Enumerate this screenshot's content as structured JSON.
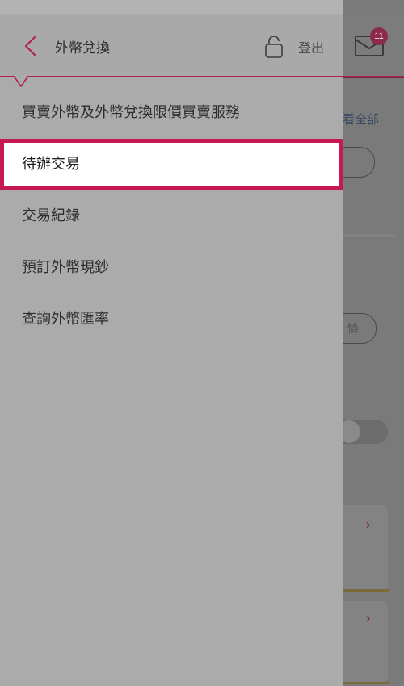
{
  "header": {
    "title": "外幣兌換",
    "logout_label": "登出",
    "mail_badge_count": "11"
  },
  "menu": {
    "items": [
      {
        "label": "買賣外幣及外幣兌換限價買賣服務"
      },
      {
        "label": "待辦交易",
        "selected": true
      },
      {
        "label": "交易紀錄"
      },
      {
        "label": "預訂外幣現鈔"
      },
      {
        "label": "查詢外幣匯率"
      }
    ]
  },
  "background": {
    "view_all_partial": "看全部",
    "details_partial": "情"
  },
  "colors": {
    "accent": "#c41955",
    "divider": "#b0234f",
    "badge": "#8c2a49"
  }
}
